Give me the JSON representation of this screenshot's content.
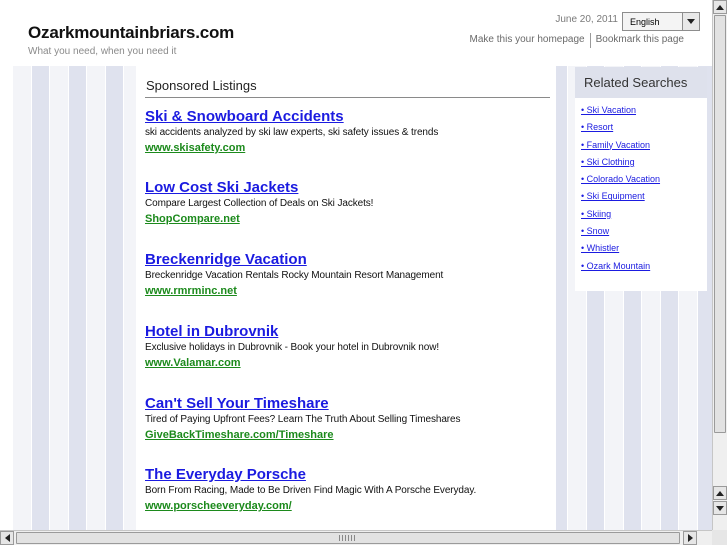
{
  "header": {
    "site_title": "Ozarkmountainbriars.com",
    "tagline": "What you need, when you need it",
    "date": "June 20, 2011",
    "language_selected": "English",
    "links": {
      "homepage": "Make this your homepage",
      "bookmark": "Bookmark this page"
    }
  },
  "main": {
    "heading": "Sponsored Listings",
    "listings": [
      {
        "title": "Ski & Snowboard Accidents",
        "desc": "ski accidents analyzed by ski law experts, ski safety issues & trends",
        "url": "www.skisafety.com"
      },
      {
        "title": "Low Cost Ski Jackets",
        "desc": "Compare Largest Collection of Deals on Ski Jackets!",
        "url": "ShopCompare.net"
      },
      {
        "title": "Breckenridge Vacation",
        "desc": "Breckenridge Vacation Rentals Rocky Mountain Resort Management",
        "url": "www.rmrminc.net"
      },
      {
        "title": "Hotel in Dubrovnik",
        "desc": "Exclusive holidays in Dubrovnik - Book your hotel in Dubrovnik now!",
        "url": "www.Valamar.com"
      },
      {
        "title": "Can't Sell Your Timeshare",
        "desc": "Tired of Paying Upfront Fees? Learn The Truth About Selling Timeshares",
        "url": "GiveBackTimeshare.com/Timeshare"
      },
      {
        "title": "The Everyday Porsche",
        "desc": "Born From Racing, Made to Be Driven Find Magic With A Porsche Everyday.",
        "url": "www.porscheeveryday.com/"
      }
    ]
  },
  "related": {
    "heading": "Related Searches",
    "items": [
      "• Ski Vacation",
      "• Resort",
      "• Family Vacation",
      "• Ski Clothing",
      "• Colorado Vacation",
      "• Ski Equipment",
      "• Skiing",
      "• Snow",
      "• Whistler",
      "• Ozark Mountain"
    ]
  },
  "colors": {
    "link_blue": "#1b1be0",
    "url_green": "#1c8a1c",
    "stripe_light": "#f3f4f8",
    "stripe_dark": "#dfe2ee"
  }
}
